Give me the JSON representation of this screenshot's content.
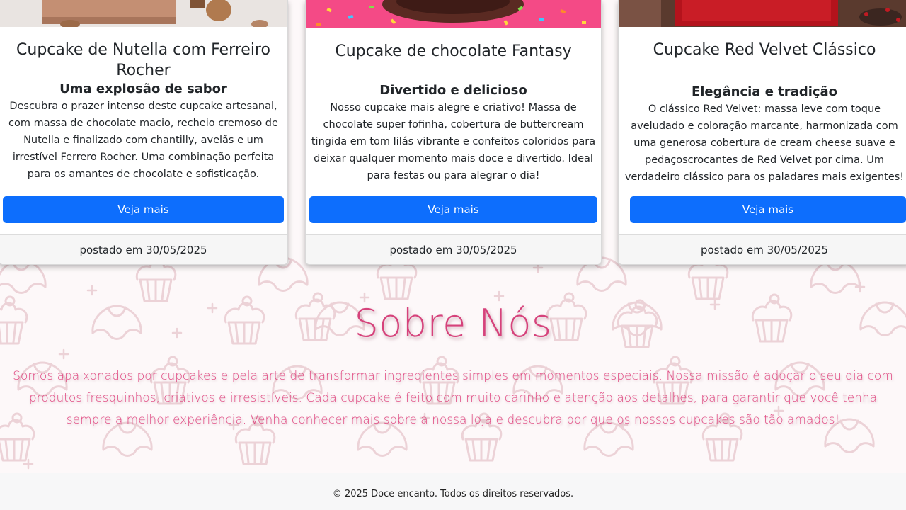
{
  "cards": [
    {
      "title": "Cupcake de Nutella com Ferreiro Rocher",
      "subtitle": "Uma explosão de sabor",
      "text": "Descubra o prazer intenso deste cupcake artesanal, com massa de chocolate macio, recheio cremoso de Nutella e finalizado com chantilly, avelãs e um irrestível Ferrero Rocher. Uma combinação perfeita para os amantes de chocolate e sofisticação.",
      "button": "Veja mais",
      "footer": "postado em 30/05/2025"
    },
    {
      "title": "Cupcake de chocolate Fantasy",
      "subtitle": "Divertido e delicioso",
      "text": "Nosso cupcake mais alegre e criativo! Massa de chocolate super fofinha, cobertura de buttercream tingida em tom lilás vibrante e confeitos coloridos para deixar qualquer momento mais doce e divertido. Ideal para festas ou para alegrar o dia!",
      "button": "Veja mais",
      "footer": "postado em 30/05/2025"
    },
    {
      "title": "Cupcake Red Velvet Clássico",
      "subtitle": "Elegância e tradição",
      "text": "O clássico Red Velvet: massa leve com toque aveludado e coloração marcante, harmonizada com uma generosa cobertura de cream cheese suave e pedaçoscrocantes de Red Velvet por cima. Um verdadeiro clássico para os paladares mais exigentes!",
      "button": "Veja mais",
      "footer": "postado em 30/05/2025"
    }
  ],
  "about": {
    "title": "Sobre Nós",
    "text": "Somos apaixonados por cupcakes e pela arte de transformar ingredientes simples em momentos especiais. Nossa missão é adoçar o seu dia com produtos fresquinhos, criativos e irresistíveis. Cada cupcake é feito com muito carinho e atenção aos detalhes, para garantir que você tenha sempre a melhor experiência. Venha conhecer mais sobre a nossa loja e descubra por que os nossos cupcakes são tão amados!"
  },
  "footer": {
    "copyright": "© 2025 Doce encanto. Todos os direitos reservados."
  },
  "colors": {
    "button": "#0d6efd",
    "about_heading": "#d6427b",
    "about_text": "#e0457f",
    "pattern": "#e8c9cf"
  }
}
